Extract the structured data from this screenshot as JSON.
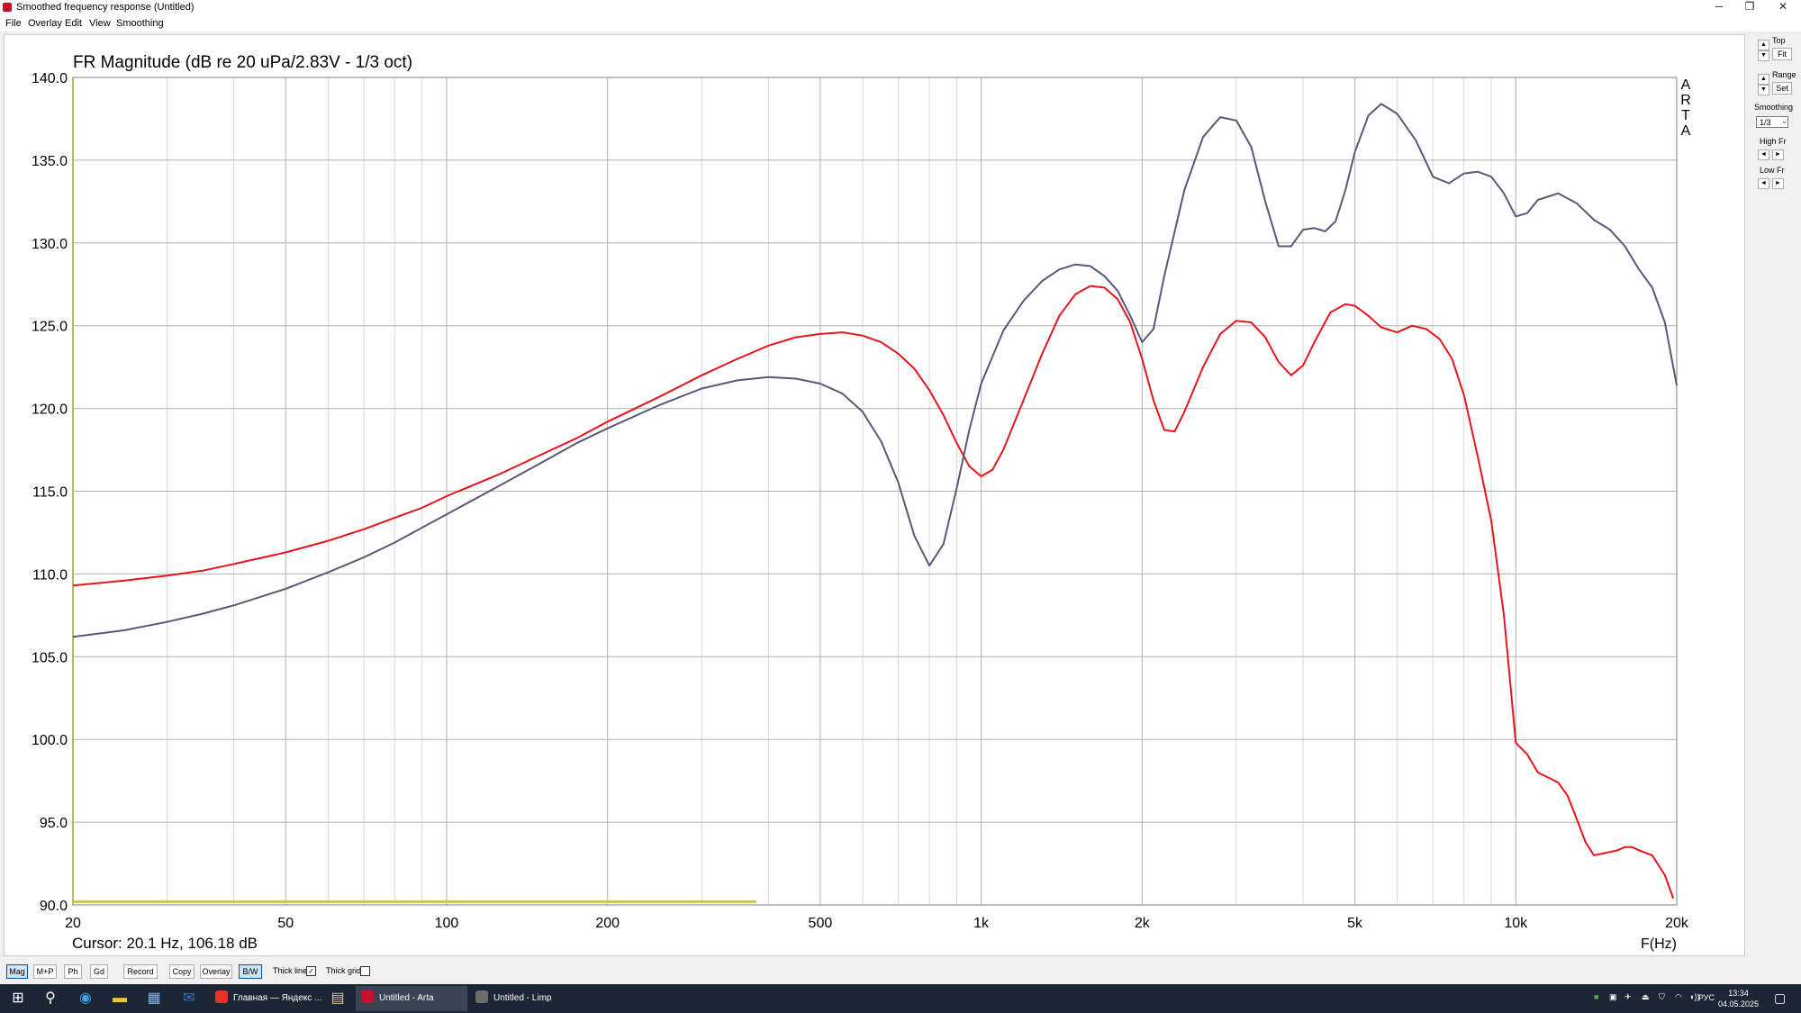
{
  "window": {
    "title": "Smoothed frequency response (Untitled)",
    "controls": {
      "minimize": "─",
      "restore": "❐",
      "close": "✕"
    }
  },
  "menu": [
    "File",
    "Overlay",
    "Edit",
    "View",
    "Smoothing"
  ],
  "chart_data": {
    "type": "line",
    "title": "FR Magnitude (dB re 20 uPa/2.83V - 1/3 oct)",
    "xlabel": "F(Hz)",
    "ylabel": "",
    "xscale": "log",
    "xlim": [
      20,
      20000
    ],
    "ylim": [
      90,
      140
    ],
    "grid": true,
    "logo": "ARTA",
    "x_ticks": [
      {
        "v": 20,
        "label": "20"
      },
      {
        "v": 50,
        "label": "50"
      },
      {
        "v": 100,
        "label": "100"
      },
      {
        "v": 200,
        "label": "200"
      },
      {
        "v": 500,
        "label": "500"
      },
      {
        "v": 1000,
        "label": "1k"
      },
      {
        "v": 2000,
        "label": "2k"
      },
      {
        "v": 5000,
        "label": "5k"
      },
      {
        "v": 10000,
        "label": "10k"
      },
      {
        "v": 20000,
        "label": "20k"
      }
    ],
    "y_ticks": [
      {
        "v": 90,
        "label": "90.0"
      },
      {
        "v": 95,
        "label": "95.0"
      },
      {
        "v": 100,
        "label": "100.0"
      },
      {
        "v": 105,
        "label": "105.0"
      },
      {
        "v": 110,
        "label": "110.0"
      },
      {
        "v": 115,
        "label": "115.0"
      },
      {
        "v": 120,
        "label": "120.0"
      },
      {
        "v": 125,
        "label": "125.0"
      },
      {
        "v": 130,
        "label": "130.0"
      },
      {
        "v": 135,
        "label": "135.0"
      },
      {
        "v": 140,
        "label": "140.0"
      }
    ],
    "series": [
      {
        "color": "#e8141c",
        "points": [
          [
            20,
            109.3
          ],
          [
            25,
            109.6
          ],
          [
            30,
            109.9
          ],
          [
            35,
            110.2
          ],
          [
            40,
            110.6
          ],
          [
            50,
            111.3
          ],
          [
            60,
            112.0
          ],
          [
            70,
            112.7
          ],
          [
            80,
            113.4
          ],
          [
            90,
            114.0
          ],
          [
            100,
            114.7
          ],
          [
            125,
            116.0
          ],
          [
            150,
            117.2
          ],
          [
            175,
            118.2
          ],
          [
            200,
            119.2
          ],
          [
            250,
            120.7
          ],
          [
            300,
            122.0
          ],
          [
            350,
            123.0
          ],
          [
            400,
            123.8
          ],
          [
            450,
            124.3
          ],
          [
            500,
            124.5
          ],
          [
            550,
            124.6
          ],
          [
            600,
            124.4
          ],
          [
            650,
            124.0
          ],
          [
            700,
            123.3
          ],
          [
            750,
            122.4
          ],
          [
            800,
            121.1
          ],
          [
            850,
            119.6
          ],
          [
            900,
            117.9
          ],
          [
            950,
            116.5
          ],
          [
            1000,
            115.9
          ],
          [
            1050,
            116.3
          ],
          [
            1100,
            117.5
          ],
          [
            1200,
            120.5
          ],
          [
            1300,
            123.3
          ],
          [
            1400,
            125.6
          ],
          [
            1500,
            126.9
          ],
          [
            1600,
            127.4
          ],
          [
            1700,
            127.3
          ],
          [
            1800,
            126.6
          ],
          [
            1900,
            125.2
          ],
          [
            2000,
            123.0
          ],
          [
            2100,
            120.5
          ],
          [
            2200,
            118.7
          ],
          [
            2300,
            118.6
          ],
          [
            2400,
            119.8
          ],
          [
            2600,
            122.5
          ],
          [
            2800,
            124.5
          ],
          [
            3000,
            125.3
          ],
          [
            3200,
            125.2
          ],
          [
            3400,
            124.3
          ],
          [
            3600,
            122.8
          ],
          [
            3800,
            122.0
          ],
          [
            4000,
            122.6
          ],
          [
            4200,
            124.0
          ],
          [
            4500,
            125.8
          ],
          [
            4800,
            126.3
          ],
          [
            5000,
            126.2
          ],
          [
            5300,
            125.6
          ],
          [
            5600,
            124.9
          ],
          [
            6000,
            124.6
          ],
          [
            6400,
            125.0
          ],
          [
            6800,
            124.8
          ],
          [
            7200,
            124.2
          ],
          [
            7600,
            123.0
          ],
          [
            8000,
            120.8
          ],
          [
            8500,
            117.0
          ],
          [
            9000,
            113.2
          ],
          [
            9500,
            107.5
          ],
          [
            10000,
            99.8
          ],
          [
            10500,
            99.1
          ],
          [
            11000,
            98.0
          ],
          [
            11500,
            97.7
          ],
          [
            12000,
            97.4
          ],
          [
            12500,
            96.6
          ],
          [
            13000,
            95.2
          ],
          [
            13500,
            93.8
          ],
          [
            14000,
            93.0
          ],
          [
            14500,
            93.1
          ],
          [
            15000,
            93.2
          ],
          [
            15500,
            93.3
          ],
          [
            16000,
            93.5
          ],
          [
            16500,
            93.5
          ],
          [
            17000,
            93.3
          ],
          [
            18000,
            93.0
          ],
          [
            19000,
            91.8
          ],
          [
            19700,
            90.4
          ]
        ]
      },
      {
        "color": "#5a5878",
        "points": [
          [
            20,
            106.2
          ],
          [
            25,
            106.6
          ],
          [
            30,
            107.1
          ],
          [
            35,
            107.6
          ],
          [
            40,
            108.1
          ],
          [
            50,
            109.1
          ],
          [
            60,
            110.1
          ],
          [
            70,
            111.0
          ],
          [
            80,
            111.9
          ],
          [
            90,
            112.8
          ],
          [
            100,
            113.6
          ],
          [
            125,
            115.3
          ],
          [
            150,
            116.7
          ],
          [
            175,
            117.9
          ],
          [
            200,
            118.8
          ],
          [
            250,
            120.2
          ],
          [
            300,
            121.2
          ],
          [
            350,
            121.7
          ],
          [
            400,
            121.9
          ],
          [
            450,
            121.8
          ],
          [
            500,
            121.5
          ],
          [
            550,
            120.9
          ],
          [
            600,
            119.8
          ],
          [
            650,
            118.0
          ],
          [
            700,
            115.5
          ],
          [
            750,
            112.3
          ],
          [
            800,
            110.5
          ],
          [
            850,
            111.8
          ],
          [
            900,
            115.2
          ],
          [
            950,
            118.7
          ],
          [
            1000,
            121.5
          ],
          [
            1100,
            124.7
          ],
          [
            1200,
            126.5
          ],
          [
            1300,
            127.7
          ],
          [
            1400,
            128.4
          ],
          [
            1500,
            128.7
          ],
          [
            1600,
            128.6
          ],
          [
            1700,
            128.0
          ],
          [
            1800,
            127.1
          ],
          [
            1900,
            125.6
          ],
          [
            2000,
            124.0
          ],
          [
            2100,
            124.8
          ],
          [
            2200,
            128.0
          ],
          [
            2400,
            133.2
          ],
          [
            2600,
            136.4
          ],
          [
            2800,
            137.6
          ],
          [
            3000,
            137.4
          ],
          [
            3200,
            135.8
          ],
          [
            3400,
            132.5
          ],
          [
            3600,
            129.8
          ],
          [
            3800,
            129.8
          ],
          [
            4000,
            130.8
          ],
          [
            4200,
            130.9
          ],
          [
            4400,
            130.7
          ],
          [
            4600,
            131.3
          ],
          [
            4800,
            133.2
          ],
          [
            5000,
            135.5
          ],
          [
            5300,
            137.7
          ],
          [
            5600,
            138.4
          ],
          [
            6000,
            137.8
          ],
          [
            6500,
            136.2
          ],
          [
            7000,
            134.0
          ],
          [
            7500,
            133.6
          ],
          [
            8000,
            134.2
          ],
          [
            8500,
            134.3
          ],
          [
            9000,
            134.0
          ],
          [
            9500,
            133.0
          ],
          [
            10000,
            131.6
          ],
          [
            10500,
            131.8
          ],
          [
            11000,
            132.6
          ],
          [
            12000,
            133.0
          ],
          [
            13000,
            132.4
          ],
          [
            14000,
            131.4
          ],
          [
            15000,
            130.8
          ],
          [
            16000,
            129.8
          ],
          [
            17000,
            128.4
          ],
          [
            18000,
            127.3
          ],
          [
            19000,
            125.2
          ],
          [
            20000,
            121.4
          ]
        ]
      }
    ],
    "cursor_marker": {
      "color": "#c8c84a",
      "x_start": 20,
      "x_end": 380,
      "y": 90.2
    }
  },
  "cursor": "Cursor: 20.1 Hz, 106.18 dB",
  "right_panel": {
    "top_label": "Top",
    "fit_label": "Fit",
    "range_label": "Range",
    "set_label": "Set",
    "smoothing_label": "Smoothing",
    "smoothing_value": "1/3",
    "highfr_label": "High Fr",
    "lowfr_label": "Low Fr",
    "up_arrow": "▲",
    "down_arrow": "▼",
    "left_arrow": "◄",
    "right_arrow": "►"
  },
  "bottom_bar": {
    "buttons": [
      "Mag",
      "M+P",
      "Ph",
      "Gd",
      "Record",
      "Copy",
      "Overlay",
      "B/W"
    ],
    "thick_line_label": "Thick line",
    "thick_line_checked": "✓",
    "thick_grid_label": "Thick grid",
    "thick_grid_checked": ""
  },
  "taskbar": {
    "tasks": [
      {
        "label": "Главная — Яндекс ...",
        "color": "#e8332a"
      },
      {
        "label": "Untitled - Arta",
        "color": "#c8102e"
      },
      {
        "label": "Untitled - Limp",
        "color": "#6c6c6c"
      }
    ],
    "language": "РУС",
    "time": "13:34",
    "date": "04.05.2025"
  }
}
